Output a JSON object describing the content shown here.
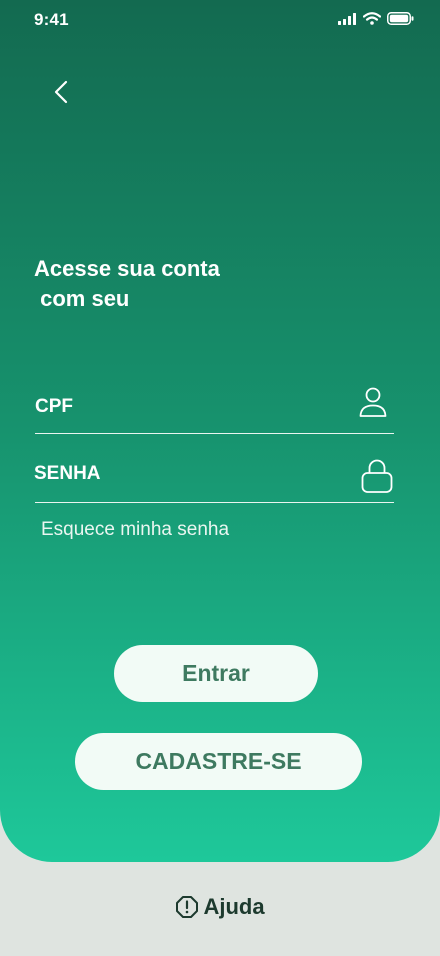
{
  "status_bar": {
    "time": "9:41"
  },
  "login": {
    "title": "Acesse sua conta\n com seu",
    "cpf_label": "CPF",
    "password_label": "SENHA",
    "forgot_password": "Esquece minha senha",
    "login_button": "Entrar",
    "signup_button": "CADASTRE-SE"
  },
  "footer": {
    "help_label": "Ajuda"
  },
  "icons": {
    "back": "chevron-left-icon",
    "cpf_field": "user-icon",
    "password_field": "lock-icon",
    "help": "alert-octagon-icon"
  },
  "colors": {
    "gradient_top": "#136a50",
    "gradient_bottom": "#1ec89a",
    "button_bg": "#f2fbf6",
    "button_text": "#3e7a60",
    "page_bg": "#dfe4e0"
  }
}
